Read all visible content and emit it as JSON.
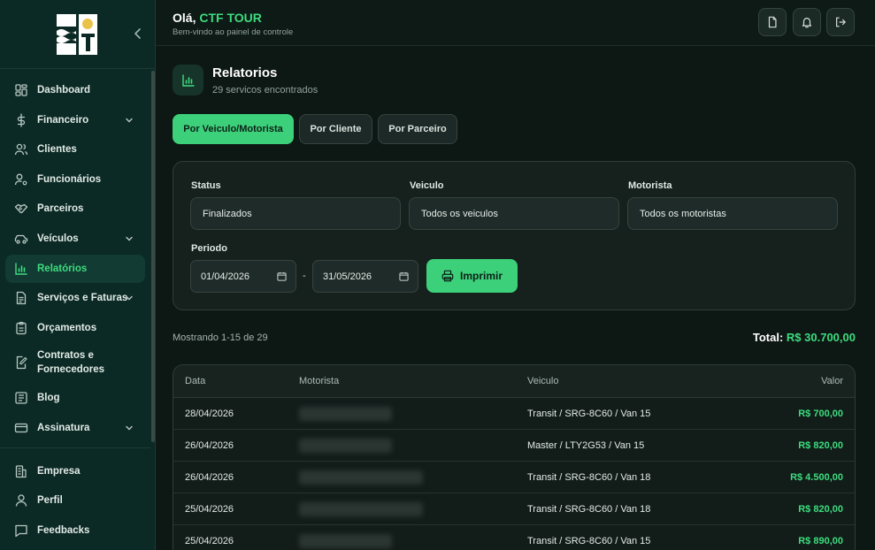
{
  "sidebar": {
    "items": [
      {
        "label": "Dashboard",
        "icon": "grid-icon"
      },
      {
        "label": "Financeiro",
        "icon": "dollar-icon",
        "expandable": true
      },
      {
        "label": "Clientes",
        "icon": "users-icon"
      },
      {
        "label": "Funcionários",
        "icon": "user-cog-icon"
      },
      {
        "label": "Parceiros",
        "icon": "handshake-icon"
      },
      {
        "label": "Veículos",
        "icon": "car-icon",
        "expandable": true
      },
      {
        "label": "Relatórios",
        "icon": "bar-chart-icon",
        "active": true
      },
      {
        "label": "Serviços e Faturas",
        "icon": "file-list-icon",
        "expandable": true
      },
      {
        "label": "Orçamentos",
        "icon": "clipboard-icon"
      },
      {
        "label": "Contratos e Fornecedores",
        "icon": "file-edit-icon"
      },
      {
        "label": "Blog",
        "icon": "book-icon"
      },
      {
        "label": "Assinatura",
        "icon": "credit-card-icon",
        "expandable": true
      }
    ],
    "bottom_items": [
      {
        "label": "Empresa",
        "icon": "building-icon"
      },
      {
        "label": "Perfil",
        "icon": "user-icon"
      },
      {
        "label": "Feedbacks",
        "icon": "message-icon"
      }
    ]
  },
  "header": {
    "greeting_prefix": "Olá,",
    "company": "CTF TOUR",
    "subtitle": "Bem-vindo ao painel de controle"
  },
  "page": {
    "title": "Relatorios",
    "subtitle": "29 servicos encontrados"
  },
  "tabs": [
    {
      "label": "Por Veiculo/Motorista",
      "active": true
    },
    {
      "label": "Por Cliente",
      "active": false
    },
    {
      "label": "Por Parceiro",
      "active": false
    }
  ],
  "filters": {
    "status_label": "Status",
    "status_value": "Finalizados",
    "vehicle_label": "Veiculo",
    "vehicle_value": "Todos os veiculos",
    "driver_label": "Motorista",
    "driver_value": "Todos os motoristas",
    "period_label": "Periodo",
    "date_from": "01/04/2026",
    "date_to": "31/05/2026",
    "separator": "-",
    "print_label": "Imprimir"
  },
  "summary": {
    "showing": "Mostrando 1-15 de 29",
    "total_label": "Total:",
    "total_value": "R$ 30.700,00"
  },
  "table": {
    "headers": {
      "date": "Data",
      "driver": "Motorista",
      "vehicle": "Veiculo",
      "value": "Valor"
    },
    "rows": [
      {
        "date": "28/04/2026",
        "vehicle": "Transit / SRG-8C60 / Van 15",
        "value": "R$ 700,00"
      },
      {
        "date": "26/04/2026",
        "vehicle": "Master / LTY2G53 / Van 15",
        "value": "R$ 820,00"
      },
      {
        "date": "26/04/2026",
        "vehicle": "Transit / SRG-8C60 / Van 18",
        "value": "R$ 4.500,00"
      },
      {
        "date": "25/04/2026",
        "vehicle": "Transit / SRG-8C60 / Van 18",
        "value": "R$ 820,00"
      },
      {
        "date": "25/04/2026",
        "vehicle": "Transit / SRG-8C60 / Van 15",
        "value": "R$ 890,00"
      }
    ]
  }
}
